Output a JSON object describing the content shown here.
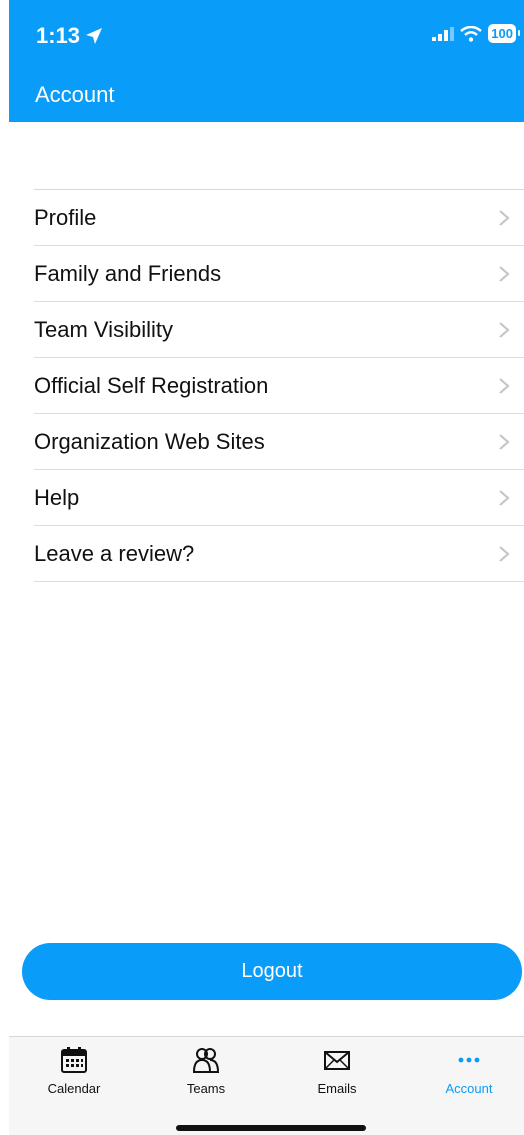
{
  "status_bar": {
    "time": "1:13",
    "battery": "100"
  },
  "header": {
    "title": "Account"
  },
  "menu": {
    "items": [
      {
        "label": "Profile"
      },
      {
        "label": "Family and Friends"
      },
      {
        "label": "Team Visibility"
      },
      {
        "label": "Official Self Registration"
      },
      {
        "label": "Organization Web Sites"
      },
      {
        "label": "Help"
      },
      {
        "label": "Leave a review?"
      }
    ]
  },
  "logout": {
    "label": "Logout"
  },
  "tabbar": {
    "tabs": [
      {
        "label": "Calendar",
        "icon": "calendar-icon"
      },
      {
        "label": "Teams",
        "icon": "teams-icon"
      },
      {
        "label": "Emails",
        "icon": "envelope-icon"
      },
      {
        "label": "Account",
        "icon": "more-dots-icon",
        "active": true
      }
    ]
  },
  "colors": {
    "accent": "#0a9cf9",
    "text": "#111111",
    "divider": "#dcdcdc"
  }
}
